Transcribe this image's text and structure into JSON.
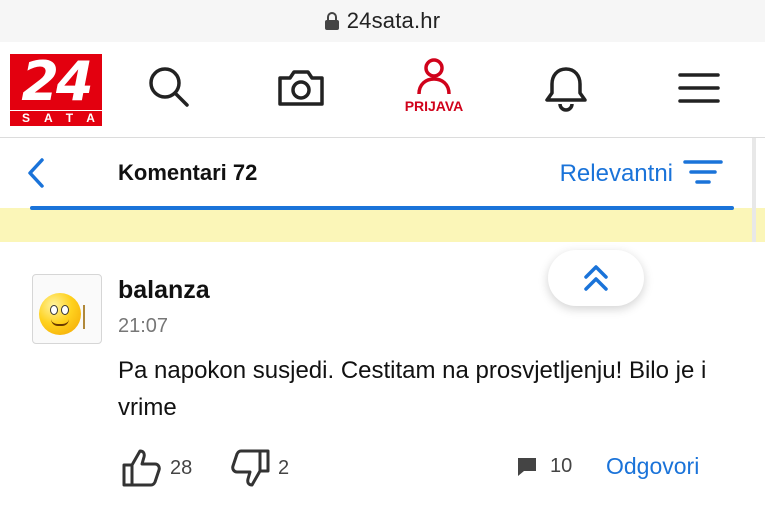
{
  "browser": {
    "url": "24sata.hr"
  },
  "header": {
    "logo_number": "24",
    "logo_sub": "SATA",
    "login_label": "PRIJAVA",
    "icons": [
      "search-icon",
      "camera-icon",
      "user-icon",
      "bell-icon",
      "menu-icon"
    ]
  },
  "comments_bar": {
    "title": "Komentari 72",
    "sort_label": "Relevantni"
  },
  "comment": {
    "username": "balanza",
    "time": "21:07",
    "text": "Pa napokon susjedi. Cestitam na prosvjetljenju! Bilo je i vrime",
    "likes": "28",
    "dislikes": "2",
    "replies_count": "10",
    "reply_label": "Odgovori"
  },
  "colors": {
    "accent": "#1a73d9",
    "brand": "#e3000f",
    "highlight": "#fbf6b8"
  }
}
